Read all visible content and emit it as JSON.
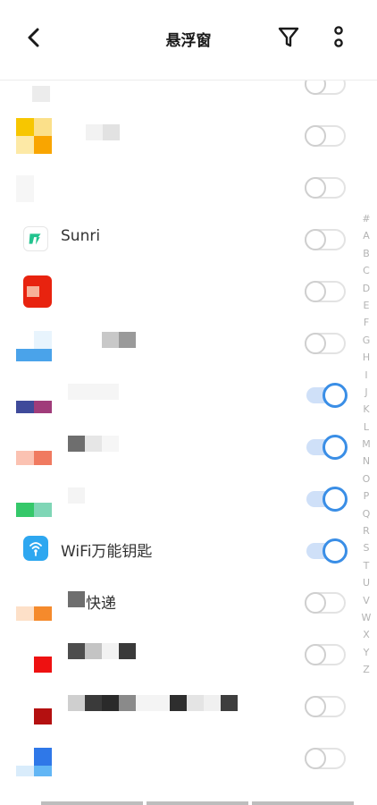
{
  "header": {
    "title": "悬浮窗",
    "back_icon": "back-arrow-icon",
    "filter_icon": "filter-icon",
    "more_icon": "more-vertical-icon"
  },
  "apps": [
    {
      "label": "",
      "on": false,
      "icon": "obscured-app-icon"
    },
    {
      "label": "",
      "on": false,
      "icon": "yellow-app-icon"
    },
    {
      "label": "",
      "on": false,
      "icon": "obscured-app-icon"
    },
    {
      "label": "Sunri",
      "on": false,
      "icon": "sunri-app-icon"
    },
    {
      "label": "",
      "on": false,
      "icon": "red-app-icon"
    },
    {
      "label": "",
      "on": false,
      "icon": "blue-app-icon"
    },
    {
      "label": "",
      "on": true,
      "icon": "purple-app-icon"
    },
    {
      "label": "",
      "on": true,
      "icon": "orange-app-icon"
    },
    {
      "label": "",
      "on": true,
      "icon": "green-app-icon"
    },
    {
      "label": "WiFi万能钥匙",
      "on": true,
      "icon": "wifi-app-icon"
    },
    {
      "label": "快递",
      "on": false,
      "icon": "orange-app-icon"
    },
    {
      "label": "",
      "on": false,
      "icon": "red-app-icon"
    },
    {
      "label": "",
      "on": false,
      "icon": "darkred-app-icon"
    },
    {
      "label": "",
      "on": false,
      "icon": "blue-app-icon"
    }
  ],
  "index_letters": [
    "#",
    "A",
    "B",
    "C",
    "D",
    "E",
    "F",
    "G",
    "H",
    "I",
    "J",
    "K",
    "L",
    "M",
    "N",
    "O",
    "P",
    "Q",
    "R",
    "S",
    "T",
    "U",
    "V",
    "W",
    "X",
    "Y",
    "Z"
  ],
  "colors": {
    "accent": "#3a8ee6",
    "toggle_on_track": "#cfe0f8",
    "wifi": "#2ea7f0",
    "sunri": "#22c38e"
  }
}
